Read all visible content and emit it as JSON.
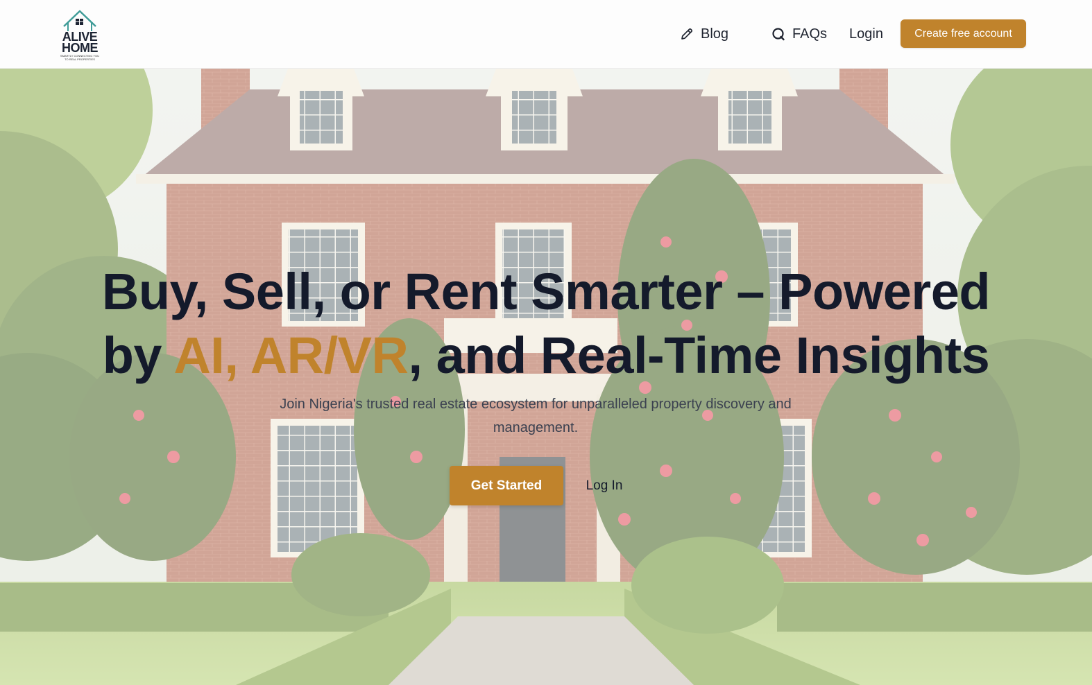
{
  "nav": {
    "logo": {
      "line1": "ALIVE",
      "line2": "HOME",
      "tagline": "SMARTLY CONNECTING YOU TO REAL PROPERTIES"
    },
    "blog_label": "Blog",
    "faqs_label": "FAQs",
    "login_label": "Login",
    "cta_label": "Create free account"
  },
  "hero": {
    "headline_part1": "Buy, Sell, or Rent Smarter – Powered",
    "headline_by": "by ",
    "headline_accent": "AI, AR/VR",
    "headline_part2": ", and Real-Time Insights",
    "subtitle": "Join Nigeria's trusted real estate ecosystem for unparalleled property discovery and management.",
    "primary_button": "Get Started",
    "secondary_button": "Log In"
  },
  "colors": {
    "accent": "#c0832c",
    "text_dark": "#141a2b"
  }
}
